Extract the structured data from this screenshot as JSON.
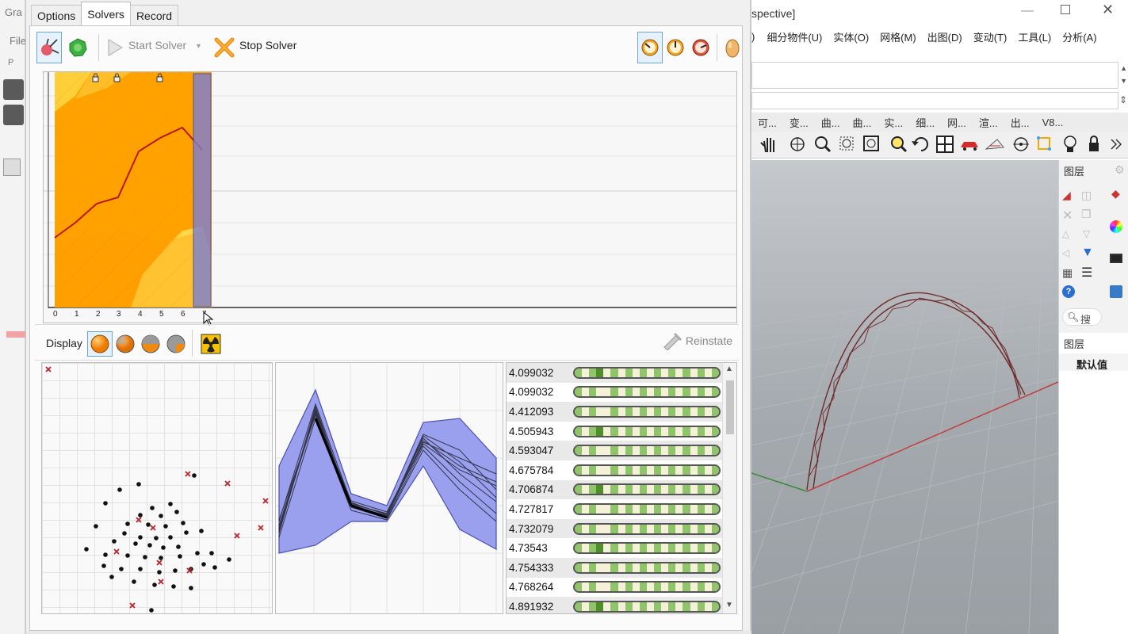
{
  "background_app": {
    "title_fragment": "Gra",
    "menu_fragment": "File",
    "field_fragment": "P"
  },
  "solver_window": {
    "tabs": [
      "Options",
      "Solvers",
      "Record"
    ],
    "active_tab": "Solvers",
    "toolbar": {
      "start_label": "Start Solver",
      "stop_label": "Stop Solver"
    },
    "fitness_chart": {
      "x_ticks": [
        "0",
        "1",
        "2",
        "3",
        "4",
        "5",
        "6",
        "7"
      ],
      "selected_generation": 7,
      "colors": {
        "fill": "#ffa200",
        "light": "#ffd84a",
        "median": "#b8141c",
        "selection": "#7b7fd6"
      }
    },
    "display": {
      "label": "Display",
      "reinstate_label": "Reinstate"
    },
    "fitness_values": [
      "4.099032",
      "4.099032",
      "4.412093",
      "4.505943",
      "4.593047",
      "4.675784",
      "4.706874",
      "4.727817",
      "4.732079",
      "4.73543",
      "4.754333",
      "4.768264",
      "4.891932"
    ]
  },
  "rhino": {
    "title_fragment": "spective]",
    "menu": [
      "细分物件(U)",
      "实体(O)",
      "网格(M)",
      "出图(D)",
      "变动(T)",
      "工具(L)",
      "分析(A)"
    ],
    "menu_lead": ")",
    "toolbar_tabs": [
      "可...",
      "变...",
      "曲...",
      "曲...",
      "实...",
      "细...",
      "网...",
      "渲...",
      "出...",
      "V8..."
    ],
    "layer_panel": {
      "title": "图层",
      "search_placeholder": "搜",
      "column_header": "图层",
      "default_layer": "默认值"
    }
  }
}
